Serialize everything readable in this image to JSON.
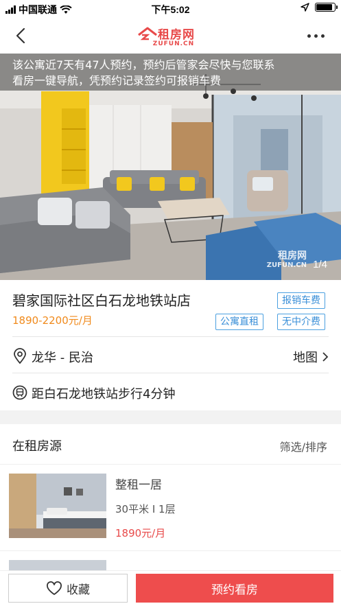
{
  "status_bar": {
    "carrier": "中国联通",
    "time": "下午5:02",
    "battery_level": 0.9
  },
  "nav": {
    "logo_text": "租房网",
    "logo_sub": "ZUFUN.CN"
  },
  "hero": {
    "notice_line1": "该公寓近7天有47人预约，预约后管家会尽快与您联系",
    "notice_line2": "看房一键导航，凭预约记录签约可报销车费",
    "photo_counter": "1/4",
    "watermark_text": "租房网",
    "watermark_sub": "ZUFUN.CN"
  },
  "info": {
    "title": "碧家国际社区白石龙地铁站店",
    "price": "1890-2200元/月",
    "tags": [
      "报销车费",
      "公寓直租",
      "无中介费"
    ],
    "district": "龙华 - 民治",
    "map_label": "地图",
    "transit": "距白石龙地铁站步行4分钟"
  },
  "listings": {
    "header": "在租房源",
    "filter_label": "筛选/排序",
    "items": [
      {
        "title": "整租一居",
        "meta": "30平米 I 1层",
        "price": "1890元/月"
      }
    ]
  },
  "bottom_bar": {
    "favorite_label": "收藏",
    "book_label": "预约看房"
  },
  "colors": {
    "brand_red": "#ee4d4d",
    "price_orange": "#f08a1c",
    "tag_blue": "#3a8fd8"
  }
}
